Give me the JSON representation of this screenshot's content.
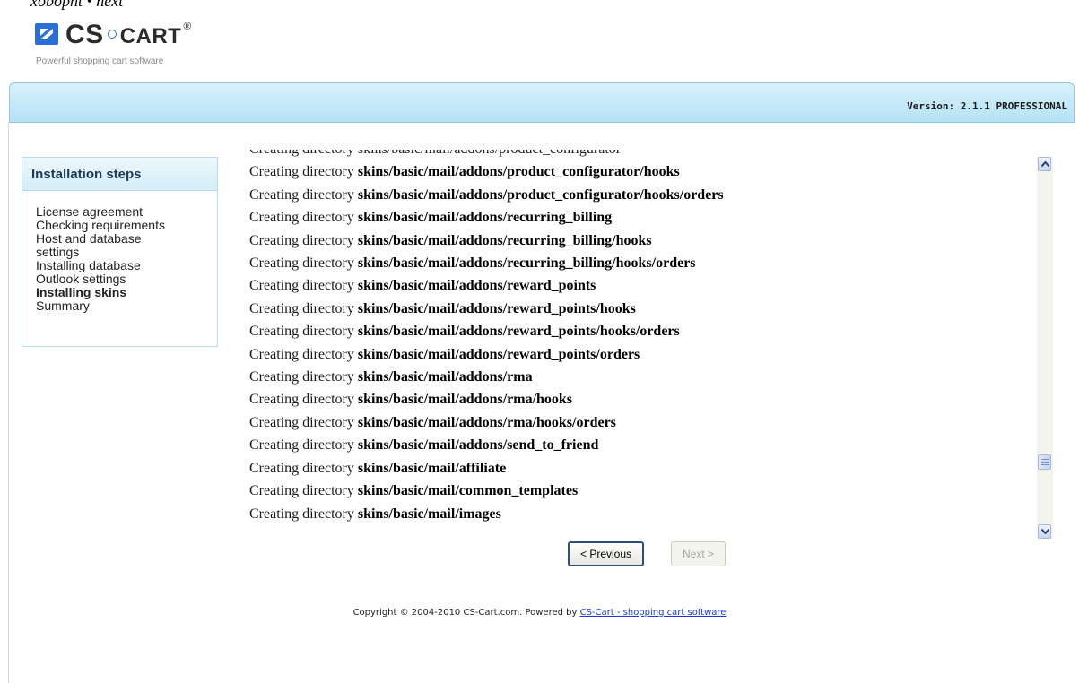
{
  "top_cut_text": "xobopht • next",
  "logo": {
    "brand_cs": "CS",
    "brand_cart": "CART",
    "registered": "®",
    "tagline": "Powerful shopping cart software"
  },
  "header": {
    "version": "Version: 2.1.1 PROFESSIONAL"
  },
  "steps": {
    "title": "Installation steps",
    "items": [
      "License agreement",
      "Checking requirements",
      "Host and database",
      "settings",
      "Installing database",
      "Outlook settings",
      "Installing skins",
      "Summary"
    ],
    "active_index": 6
  },
  "log": {
    "prefix": "Creating directory",
    "cut_line": "Creating directory skins/basic/mail/addons/product_configurator",
    "lines": [
      "skins/basic/mail/addons/product_configurator/hooks",
      "skins/basic/mail/addons/product_configurator/hooks/orders",
      "skins/basic/mail/addons/recurring_billing",
      "skins/basic/mail/addons/recurring_billing/hooks",
      "skins/basic/mail/addons/recurring_billing/hooks/orders",
      "skins/basic/mail/addons/reward_points",
      "skins/basic/mail/addons/reward_points/hooks",
      "skins/basic/mail/addons/reward_points/hooks/orders",
      "skins/basic/mail/addons/reward_points/orders",
      "skins/basic/mail/addons/rma",
      "skins/basic/mail/addons/rma/hooks",
      "skins/basic/mail/addons/rma/hooks/orders",
      "skins/basic/mail/addons/send_to_friend",
      "skins/basic/mail/affiliate",
      "skins/basic/mail/common_templates",
      "skins/basic/mail/images"
    ],
    "scroll_position": 0.87
  },
  "buttons": {
    "previous": "< Previous",
    "next": "Next >"
  },
  "footer": {
    "copyright": "Copyright © 2004-2010 CS-Cart.com. Powered by ",
    "link": "CS-Cart - shopping cart software"
  },
  "colors": {
    "accent": "#2a6fd6",
    "header_bg": "#c4e8f7",
    "link": "#1a3ad0"
  }
}
